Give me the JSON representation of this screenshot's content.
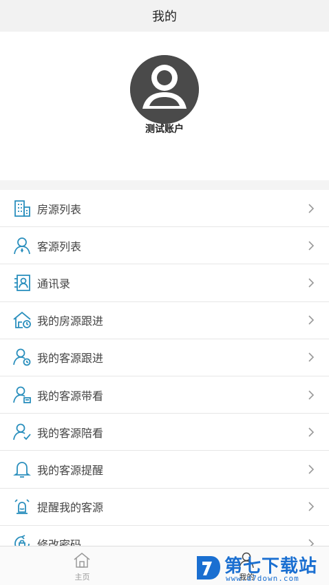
{
  "header": {
    "title": "我的"
  },
  "profile": {
    "name": "测试账户",
    "avatar_icon": "avatar-icon"
  },
  "menu": {
    "items": [
      {
        "label": "房源列表",
        "icon": "building-icon"
      },
      {
        "label": "客源列表",
        "icon": "customer-icon"
      },
      {
        "label": "通讯录",
        "icon": "contacts-icon"
      },
      {
        "label": "我的房源跟进",
        "icon": "house-follow-icon"
      },
      {
        "label": "我的客源跟进",
        "icon": "customer-follow-icon"
      },
      {
        "label": "我的客源带看",
        "icon": "customer-tour-icon"
      },
      {
        "label": "我的客源陪看",
        "icon": "customer-accompany-icon"
      },
      {
        "label": "我的客源提醒",
        "icon": "bell-icon"
      },
      {
        "label": "提醒我的客源",
        "icon": "alarm-icon"
      },
      {
        "label": "修改密码",
        "icon": "password-icon"
      }
    ]
  },
  "tabbar": {
    "home_label": "主页",
    "mine_label": "我的"
  },
  "watermark": {
    "title": "第七下载站",
    "url": "www.d7down.com"
  },
  "colors": {
    "accent": "#2a8fbd",
    "watermark": "#1a6fd1",
    "avatar": "#4a4a4a"
  }
}
